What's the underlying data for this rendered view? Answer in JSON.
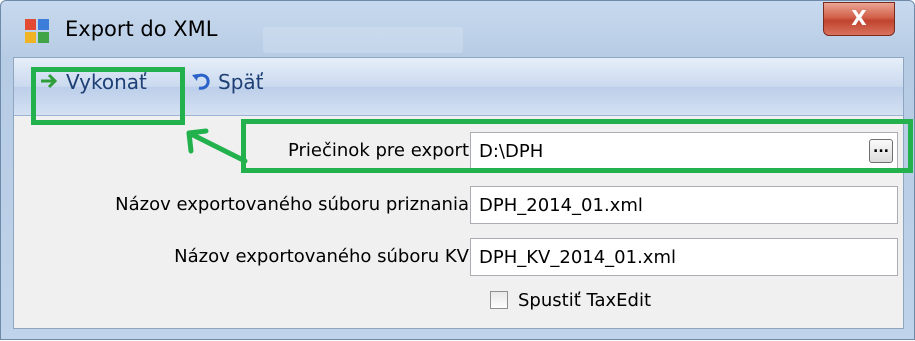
{
  "window": {
    "title": "Export do XML",
    "close_label": "X"
  },
  "toolbar": {
    "execute_label": "Vykonať",
    "back_label": "Späť"
  },
  "form": {
    "folder": {
      "label": "Priečinok pre export",
      "value": "D:\\DPH"
    },
    "return_file": {
      "label": "Názov exportovaného súboru priznania",
      "value": "DPH_2014_01.xml"
    },
    "kv_file": {
      "label": "Názov exportovaného súboru KV",
      "value": "DPH_KV_2014_01.xml"
    },
    "run_taxedit": {
      "label": "Spustiť TaxEdit",
      "checked": false
    }
  },
  "browse_label": "...",
  "colors": {
    "highlight": "#22b14c",
    "close": "#c0432e",
    "link": "#1d3f75"
  }
}
